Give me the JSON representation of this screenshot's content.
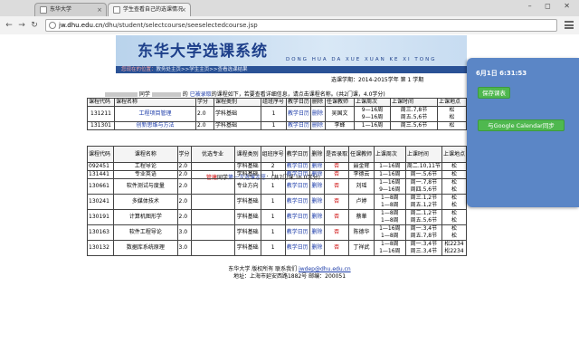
{
  "browser": {
    "tabs": [
      {
        "label": "东华大学",
        "active": false
      },
      {
        "label": "学生查看自己的选课情况",
        "active": true
      }
    ],
    "url_host": "jw.dhu.edu.cn",
    "url_path": "/dhu/student/selectcourse/seeselectedcourse.jsp"
  },
  "header": {
    "title": "东华大学选课系统",
    "pinyin": "DONG HUA DA XUE XUAN KE XI TONG",
    "crumb_prefix": "您现在的位置：",
    "crumb_path": "教务处主页>>学生主页>>查看选课结果"
  },
  "term": "选课学期：2014-2015学年 第 1 学期",
  "selected": {
    "info_prefix": "同学",
    "info_mid": "的",
    "info_link": "已被录取",
    "info_suffix": "的课程如下，若要查看详细信息，请点击课程名称。(共2门课，4.0学分)",
    "headers": [
      "课程代码",
      "课程名称",
      "学分",
      "课程类别",
      "组班序号",
      "教学日历",
      "删除",
      "任课教师",
      "上课周次",
      "上课时间",
      "上课地点"
    ],
    "rows": [
      {
        "code": "131211",
        "name": "工程项目管理",
        "credit": "2.0",
        "type": "学科基础",
        "seq": "1",
        "cal": "教学日历",
        "del": "删除",
        "teacher": "吴国文",
        "weeks": [
          "9—16周",
          "9—16周"
        ],
        "time": [
          "周三.7,8节",
          "周五.5,6节"
        ],
        "room": [
          "松",
          "松"
        ]
      },
      {
        "code": "131301",
        "name": "创新思维与方法",
        "credit": "2.0",
        "type": "学科基础",
        "seq": "1",
        "cal": "教学日历",
        "del": "删除",
        "teacher": "李蜂",
        "weeks": [
          "1—16周"
        ],
        "time": [
          "周三.5,6节"
        ],
        "room": [
          "松"
        ]
      }
    ]
  },
  "preselect": {
    "info_red": "管建",
    "info_mid": "同学",
    "info_link": "第一次选课志愿",
    "info_suffix": "：(共7门课,16.0学分)",
    "headers": [
      "课程代码",
      "课程名称",
      "学分",
      "优选专业",
      "课程类别",
      "组班序号",
      "教学日历",
      "删除",
      "是否录取",
      "任课教师",
      "上课周次",
      "上课时间",
      "上课地点"
    ],
    "rows": [
      {
        "code": "092451",
        "name": "工程导论",
        "credit": "2.0",
        "major": "",
        "type": "学科基础",
        "seq": "2",
        "cal": "教学日历",
        "del": "删除",
        "adm": "否",
        "teacher": "聂金辉",
        "weeks": [
          "1—16周"
        ],
        "time": [
          "周二.10,11节"
        ],
        "room": [
          "松"
        ]
      },
      {
        "code": "131441",
        "name": "专业英语",
        "credit": "2.0",
        "major": "",
        "type": "学科基础",
        "seq": "1",
        "cal": "教学日历",
        "del": "删除",
        "adm": "否",
        "teacher": "李德云",
        "weeks": [
          "1—16周"
        ],
        "time": [
          "周一.5,6节"
        ],
        "room": [
          "松"
        ]
      },
      {
        "code": "130661",
        "name": "软件测试与度量",
        "credit": "2.0",
        "major": "",
        "type": "专业方向",
        "seq": "1",
        "cal": "教学日历",
        "del": "删除",
        "adm": "否",
        "teacher": "刘瑶",
        "weeks": [
          "1—16周",
          "9—16周"
        ],
        "time": [
          "周一.7,8节",
          "周四.5,6节"
        ],
        "room": [
          "松",
          "松"
        ]
      },
      {
        "code": "130241",
        "name": "多媒体技术",
        "credit": "2.0",
        "major": "",
        "type": "学科基础",
        "seq": "1",
        "cal": "教学日历",
        "del": "删除",
        "adm": "否",
        "teacher": "卢婷",
        "weeks": [
          "1—8周",
          "1—8周"
        ],
        "time": [
          "周三.1,2节",
          "周五.1,2节"
        ],
        "room": [
          "松",
          "松"
        ]
      },
      {
        "code": "130191",
        "name": "计算机图形学",
        "credit": "2.0",
        "major": "",
        "type": "学科基础",
        "seq": "1",
        "cal": "教学日历",
        "del": "删除",
        "adm": "否",
        "teacher": "蔡華",
        "weeks": [
          "1—8周",
          "1—8周"
        ],
        "time": [
          "周二.1,2节",
          "周五.5,6节"
        ],
        "room": [
          "松",
          "松"
        ]
      },
      {
        "code": "130163",
        "name": "软件工程导论",
        "credit": "3.0",
        "major": "",
        "type": "学科基础",
        "seq": "1",
        "cal": "教学日历",
        "del": "删除",
        "adm": "否",
        "teacher": "陈德华",
        "weeks": [
          "1—16周",
          "1—8周"
        ],
        "time": [
          "周一.3,4节",
          "周五.7,8节"
        ],
        "room": [
          "松",
          "松"
        ]
      },
      {
        "code": "130132",
        "name": "数据库系统原理",
        "credit": "3.0",
        "major": "",
        "type": "学科基础",
        "seq": "1",
        "cal": "教学日历",
        "del": "删除",
        "adm": "否",
        "teacher": "丁祥武",
        "weeks": [
          "1—8周",
          "1—16周"
        ],
        "time": [
          "周一.3,4节",
          "周三.3,4节"
        ],
        "room": [
          "松2234",
          "松2234"
        ]
      }
    ]
  },
  "footer": {
    "line1_prefix": "东华大学 版权所有 联系我们",
    "email": "jwdep@dhu.edu.cn",
    "line2": "地址：上海市延安西路1882号 邮编：200051"
  },
  "popup": {
    "time": "6月1日 6:31:53",
    "save_label": "保存课表",
    "sync_label": "与Google Calendar同步"
  }
}
